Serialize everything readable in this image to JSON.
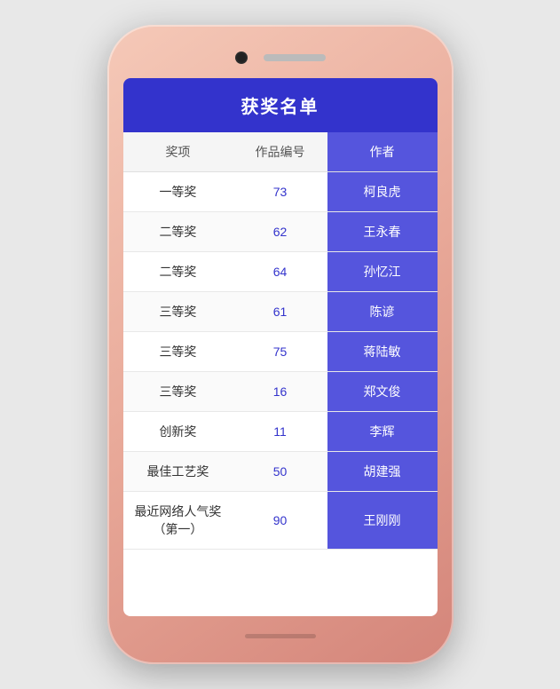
{
  "phone": {
    "title": "获奖名单"
  },
  "table": {
    "headers": {
      "award": "奖项",
      "id": "作品编号",
      "author": "作者"
    },
    "rows": [
      {
        "award": "一等奖",
        "id": "73",
        "author": "柯良虎"
      },
      {
        "award": "二等奖",
        "id": "62",
        "author": "王永春"
      },
      {
        "award": "二等奖",
        "id": "64",
        "author": "孙忆江"
      },
      {
        "award": "三等奖",
        "id": "61",
        "author": "陈谚"
      },
      {
        "award": "三等奖",
        "id": "75",
        "author": "蒋陆敏"
      },
      {
        "award": "三等奖",
        "id": "16",
        "author": "郑文俊"
      },
      {
        "award": "创新奖",
        "id": "11",
        "author": "李辉"
      },
      {
        "award": "最佳工艺奖",
        "id": "50",
        "author": "胡建强"
      },
      {
        "award": "最近网络人气奖（第一）",
        "id": "90",
        "author": "王刚刚"
      }
    ]
  }
}
